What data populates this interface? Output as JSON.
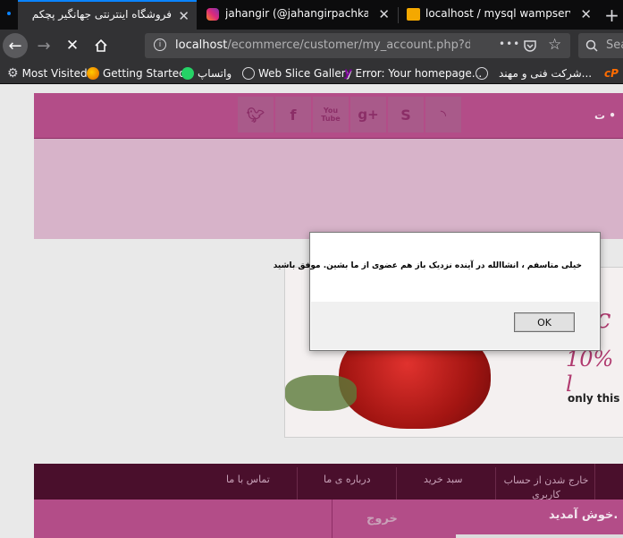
{
  "browser": {
    "tabs": [
      {
        "title": "فروشگاه اینترنتی جهانگیر پچکم",
        "active": true
      },
      {
        "title": "jahangir (@jahangirpachkam) • Ins",
        "active": false
      },
      {
        "title": "localhost / mysql wampserver / ec",
        "active": false
      }
    ],
    "new_tab_symbol": "+",
    "url_host": "localhost",
    "url_path": "/ecommerce/customer/my_account.php?delete_",
    "page_actions_symbol": "•••",
    "search_placeholder": "Sea"
  },
  "bookmarks": [
    {
      "label": "Most Visited",
      "icon": "gear-icon"
    },
    {
      "label": "Getting Started",
      "icon": "firefox-icon"
    },
    {
      "label": "واتساپ",
      "icon": "whatsapp-icon"
    },
    {
      "label": "Web Slice Gallery",
      "icon": "globe-icon"
    },
    {
      "label": "Error: Your homepage...",
      "icon": "yahoo-icon"
    },
    {
      "label": "شرکت فنی و مهند...",
      "icon": "globe-icon"
    }
  ],
  "site": {
    "header_right_text": "ت •",
    "social_icons": [
      "twitter-icon",
      "facebook-icon",
      "youtube-icon",
      "google-plus-icon",
      "skype-icon",
      "rss-icon"
    ],
    "youtube_label": "You Tube",
    "banner_text_1": "ec",
    "banner_text_2": "10% l",
    "banner_text_3": "only this m",
    "menu": [
      {
        "label": "خارج شدن از حساب کاربری"
      },
      {
        "label": "سبد خرید"
      },
      {
        "label": "درباره ی ما"
      },
      {
        "label": "تماس با ما"
      }
    ],
    "welcome": "خوش آمدید.",
    "logout": "خروج"
  },
  "dialog": {
    "message": "خیلی متاسفم ، انشاالله در آینده نزدیک باز هم عضوی از ما بشین. موفق باشید",
    "ok_label": "OK"
  },
  "colors": {
    "accent_blue": "#0a84ff",
    "site_header": "#b34d88",
    "site_banner": "#d7b3c9",
    "site_menu": "#4a0f2c"
  }
}
